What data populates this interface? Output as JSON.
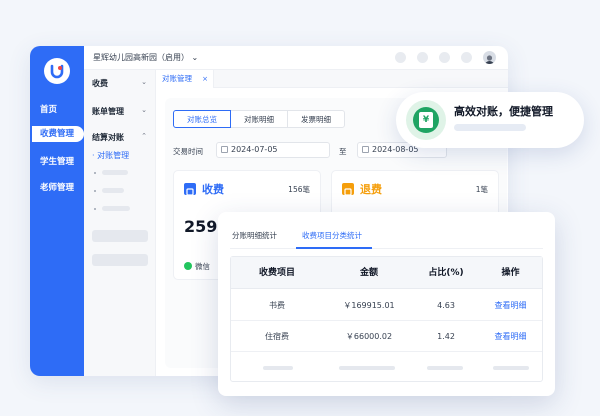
{
  "topbar": {
    "school_name": "星辉幼儿园高新园（启用）"
  },
  "nav": {
    "items": [
      {
        "label": "首页",
        "active": false
      },
      {
        "label": "收费管理",
        "active": true
      },
      {
        "label": "学生管理",
        "active": false
      },
      {
        "label": "老师管理",
        "active": false
      }
    ]
  },
  "submenu": {
    "groups": [
      "收费",
      "账单管理",
      "结算对账"
    ],
    "active_item": "对账管理"
  },
  "page_tab": {
    "label": "对账管理",
    "close": "×"
  },
  "segments": [
    "对账总览",
    "对账明细",
    "发票明细"
  ],
  "filter": {
    "time_label": "交易时间",
    "start_date": "2024-07-05",
    "to_label": "至",
    "end_date": "2024-08-05"
  },
  "cards": {
    "income": {
      "title": "收费",
      "count": "156笔",
      "amount": "259",
      "channel": "微信"
    },
    "refund": {
      "title": "退费",
      "count": "1笔"
    }
  },
  "badge": {
    "text": "高效对账，便捷管理"
  },
  "stats": {
    "tabs": [
      "分账明细统计",
      "收费项目分类统计"
    ],
    "columns": [
      "收费项目",
      "金额",
      "占比(%)",
      "操作"
    ],
    "rows": [
      {
        "item": "书费",
        "amount": "￥169915.01",
        "ratio": "4.63",
        "action": "查看明细"
      },
      {
        "item": "住宿费",
        "amount": "￥66000.02",
        "ratio": "1.42",
        "action": "查看明细"
      }
    ]
  },
  "colors": {
    "primary": "#2e6cf6",
    "green": "#1fa463",
    "orange": "#f59e0b"
  }
}
